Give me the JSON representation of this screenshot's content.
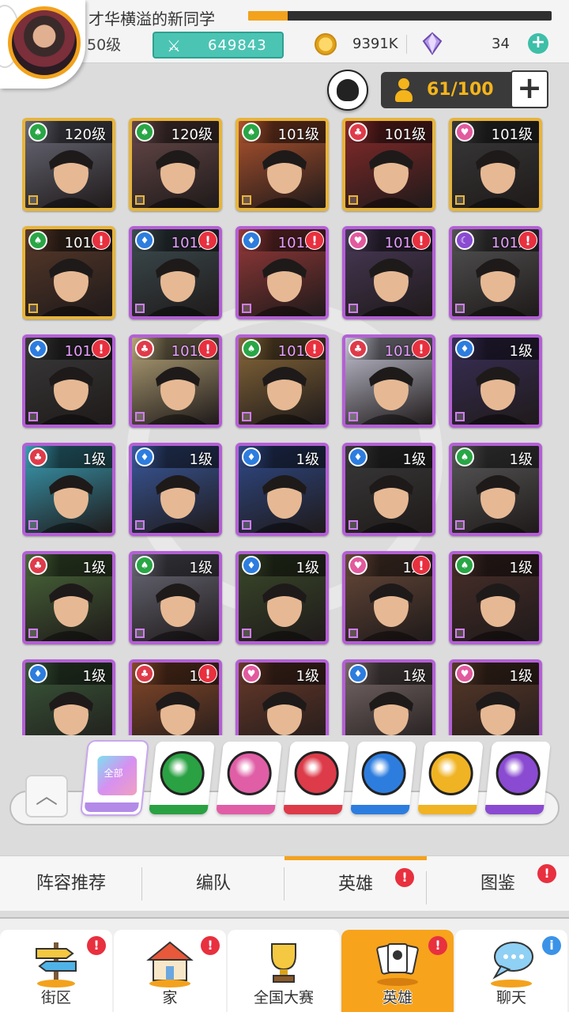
{
  "header": {
    "player_name": "才华横溢的新同学",
    "level": "50级",
    "exp_progress": 0.13,
    "power": "649843",
    "gold": "9391K",
    "gems": "34",
    "power_icon": "crossed-swords-icon",
    "gold_icon": "coin-icon",
    "gem_icon": "gem-icon"
  },
  "roster": {
    "capacity": "61/100"
  },
  "heroes": [
    {
      "level": "120级",
      "faction": "green",
      "frame": "gold",
      "alert": false,
      "hue": "#6c6c7a"
    },
    {
      "level": "120级",
      "faction": "green",
      "frame": "gold",
      "alert": false,
      "hue": "#6a4a4a"
    },
    {
      "level": "101级",
      "faction": "green",
      "frame": "gold",
      "alert": false,
      "hue": "#b4552f"
    },
    {
      "level": "101级",
      "faction": "red",
      "frame": "gold",
      "alert": false,
      "hue": "#8a2a2a"
    },
    {
      "level": "101级",
      "faction": "pink",
      "frame": "gold",
      "alert": false,
      "hue": "#3a3a3a"
    },
    {
      "level": "101级",
      "faction": "green",
      "frame": "gold",
      "alert": true,
      "hue": "#5a3a2a"
    },
    {
      "level": "101级",
      "faction": "blue",
      "frame": "purple",
      "alert": true,
      "hue": "#3d4e52"
    },
    {
      "level": "101级",
      "faction": "blue",
      "frame": "purple",
      "alert": true,
      "hue": "#9a3a3a"
    },
    {
      "level": "101级",
      "faction": "pink",
      "frame": "purple",
      "alert": true,
      "hue": "#4a3a5a"
    },
    {
      "level": "101级",
      "faction": "purple",
      "frame": "purple",
      "alert": true,
      "hue": "#555555"
    },
    {
      "level": "101级",
      "faction": "blue",
      "frame": "purple",
      "alert": true,
      "hue": "#3a3a3a"
    },
    {
      "level": "101级",
      "faction": "red",
      "frame": "purple",
      "alert": true,
      "hue": "#b8a77a"
    },
    {
      "level": "101级",
      "faction": "green",
      "frame": "purple",
      "alert": true,
      "hue": "#8a6a3a"
    },
    {
      "level": "101级",
      "faction": "red",
      "frame": "purple",
      "alert": true,
      "hue": "#c8c8d8"
    },
    {
      "level": "1级",
      "faction": "blue",
      "frame": "purple",
      "alert": false,
      "hue": "#3a2f5a"
    },
    {
      "level": "1级",
      "faction": "red",
      "frame": "purple",
      "alert": false,
      "hue": "#3aa0b8"
    },
    {
      "level": "1级",
      "faction": "blue",
      "frame": "purple",
      "alert": false,
      "hue": "#3a5aa0"
    },
    {
      "level": "1级",
      "faction": "blue",
      "frame": "purple",
      "alert": false,
      "hue": "#2f4a8a"
    },
    {
      "level": "1级",
      "faction": "blue",
      "frame": "purple",
      "alert": false,
      "hue": "#3a3a3a"
    },
    {
      "level": "1级",
      "faction": "green",
      "frame": "purple",
      "alert": false,
      "hue": "#5a5a5a"
    },
    {
      "level": "1级",
      "faction": "red",
      "frame": "purple",
      "alert": false,
      "hue": "#4a6a3a"
    },
    {
      "level": "1级",
      "faction": "green",
      "frame": "purple",
      "alert": false,
      "hue": "#6c6c7a"
    },
    {
      "level": "1级",
      "faction": "blue",
      "frame": "purple",
      "alert": false,
      "hue": "#3a4a2a"
    },
    {
      "level": "1级",
      "faction": "pink",
      "frame": "purple",
      "alert": true,
      "hue": "#6a4a3a"
    },
    {
      "level": "1级",
      "faction": "green",
      "frame": "purple",
      "alert": false,
      "hue": "#4a2f2a"
    },
    {
      "level": "1级",
      "faction": "blue",
      "frame": "purple",
      "alert": false,
      "hue": "#3a5a3a"
    },
    {
      "level": "1级",
      "faction": "red",
      "frame": "purple",
      "alert": true,
      "hue": "#8a4a2a"
    },
    {
      "level": "1级",
      "faction": "pink",
      "frame": "purple",
      "alert": false,
      "hue": "#6a3a2a"
    },
    {
      "level": "1级",
      "faction": "blue",
      "frame": "purple",
      "alert": false,
      "hue": "#7a6a6a"
    },
    {
      "level": "1级",
      "faction": "pink",
      "frame": "purple",
      "alert": false,
      "hue": "#5a3a2a"
    }
  ],
  "faction_filter": {
    "all_label": "全部",
    "tabs": [
      {
        "name": "all",
        "color": "#b38ae8"
      },
      {
        "name": "green",
        "color": "#2aa142"
      },
      {
        "name": "pink",
        "color": "#e05ea6"
      },
      {
        "name": "red",
        "color": "#dd3b49"
      },
      {
        "name": "blue",
        "color": "#2d7ddf"
      },
      {
        "name": "yellow",
        "color": "#f0b323"
      },
      {
        "name": "purple",
        "color": "#8a4ad1"
      }
    ]
  },
  "subtabs": [
    {
      "label": "阵容推荐",
      "active": false,
      "badge": false
    },
    {
      "label": "编队",
      "active": false,
      "badge": false
    },
    {
      "label": "英雄",
      "active": true,
      "badge": true
    },
    {
      "label": "图鉴",
      "active": false,
      "badge": true
    }
  ],
  "nav": [
    {
      "label": "街区",
      "icon": "signpost-icon",
      "active": false,
      "badge": "red"
    },
    {
      "label": "家",
      "icon": "house-icon",
      "active": false,
      "badge": "red"
    },
    {
      "label": "全国大赛",
      "icon": "trophy-icon",
      "active": false,
      "badge": ""
    },
    {
      "label": "英雄",
      "icon": "hero-cards-icon",
      "active": true,
      "badge": "red"
    },
    {
      "label": "聊天",
      "icon": "chat-bubble-icon",
      "active": false,
      "badge": "blue"
    }
  ],
  "colors": {
    "accent_orange": "#f3a21d",
    "alert_red": "#e8303f",
    "teal": "#4cc4b4"
  }
}
